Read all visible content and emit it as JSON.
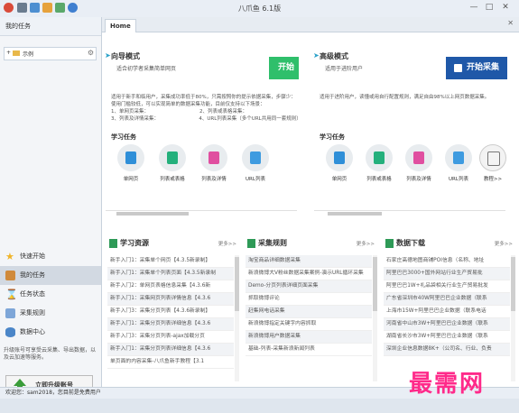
{
  "window": {
    "title": "八爪鱼 6.1版",
    "minimize": "—",
    "maximize": "□",
    "close": "✕"
  },
  "colors": {
    "accent_green": "#3a9c3a",
    "advanced_blue": "#1f58a8",
    "wizard_green": "#2fbf6b",
    "watermark": "#ff2a8a"
  },
  "left": {
    "header": "我的任务",
    "tree_item": "示例",
    "nav": [
      {
        "label": "快速开始",
        "icon": "star-icon",
        "active": false
      },
      {
        "label": "我的任务",
        "icon": "task-icon",
        "active": true
      },
      {
        "label": "任务状态",
        "icon": "hourglass-icon",
        "active": false
      },
      {
        "label": "采集规则",
        "icon": "rules-icon",
        "active": false
      },
      {
        "label": "数据中心",
        "icon": "database-icon",
        "active": false
      }
    ],
    "upgrade_note": "升级账号可享受云采集、导出数据，以及云加速等服务。",
    "upgrade_button": "立即升级账号"
  },
  "main": {
    "tab": "Home",
    "wizard": {
      "title": "向导模式",
      "subtitle": "适合初学者采集简单网页",
      "start_label": "开始",
      "description": "适用于新手和临用户，采集成功率低于80%，只需按照你的提示依据采集，步骤少：使用门槛较低，可以实现简单的数据采集功能，目前仅支持以下场景：",
      "list": [
        "1、单网页采集：",
        "2、列表或表格采集：",
        "3、列表及详情采集：",
        "4、URL列表采集（多个URL共用同一套规则）"
      ],
      "learn_title": "学习任务",
      "icons": [
        "单网页",
        "列表或表格",
        "列表及详情",
        "URL列表"
      ]
    },
    "advanced": {
      "title": "高级模式",
      "subtitle": "适用于进阶用户",
      "start_label": "开始采集",
      "description": "适用于进阶用户，读懂或用自行配置规则，满足自由98%以上网页数据采集。",
      "learn_title": "学习任务",
      "icons": [
        "单网页",
        "列表或表格",
        "列表及详情",
        "URL列表",
        "教程>>"
      ]
    },
    "resources": {
      "title": "学习资源",
      "more": "更多>>",
      "items": [
        "新手入门1：采集单个网页【4.3.5新录制】",
        "新手入门1：采集单个列表页面【4.3.5新录制",
        "新手入门2：单网页表格信息采集【4.3.6新",
        "新手入门1：采集网页列表详情信息【4.3.6",
        "新手入门3：采集分页列表【4.3.6新录制】",
        "新手入门1：采集分页列表详细信息【4.3.6",
        "新手入门3：采集分页列表-ajax加载分页",
        "新手入门1：采集分页列表详细信息【4.3.6",
        "单页面的内容采集-八爪鱼新手教程【3.1"
      ]
    },
    "rules": {
      "title": "采集规则",
      "more": "更多>>",
      "items": [
        "淘宝商品详细数据采集",
        "新浪微博大V粉丝数据采集案例-演示URL循环采集",
        "Demo-分页列表详细页面采集",
        "抓取微博评论",
        "赶集网电话采集",
        "新浪微博指定关键字内容抓取",
        "新浪微博用户数据采集",
        "基础-列表-采集新浪新闻列表"
      ]
    },
    "downloads": {
      "title": "数据下载",
      "more": "更多>>",
      "items": [
        "石家庄高德地图商铺POI信息（名称、地址",
        "阿里巴巴3000+国外网站行业生产贸易批",
        "阿里巴巴1W+礼品袋相关行业生产贸易批发",
        "广东省深圳市40W阿里巴巴企业数据（联系",
        "上海市15W+阿里巴巴企业数据（联系电话",
        "河南省中山市3W+阿里巴巴企业数据（联系",
        "湖南省长沙市3W+阿里巴巴企业数据（联系",
        "深圳企业信息数据8K+（公司名、行业、负责"
      ]
    }
  },
  "status": {
    "text": "欢迎您：sam2018，您目前是免费用户"
  },
  "watermark": "最需网"
}
